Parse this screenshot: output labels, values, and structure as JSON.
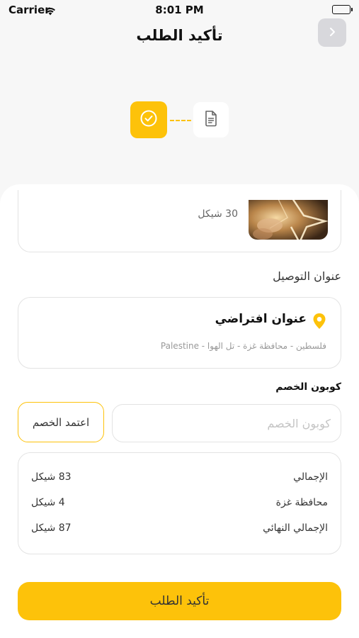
{
  "status_bar": {
    "carrier": "Carrier",
    "time": "8:01 PM"
  },
  "header": {
    "title": "تأكيد الطلب"
  },
  "steps": [
    {
      "icon": "check-circle-icon",
      "state": "completed"
    },
    {
      "icon": "document-icon",
      "state": "pending"
    }
  ],
  "product": {
    "price": "30 شيكل"
  },
  "address_section": {
    "title": "عنوان التوصيل",
    "name": "عنوان افتراضي",
    "detail": "فلسطين - محافظة غزة -   تل الهوا - Palestine"
  },
  "coupon": {
    "label": "كوبون الخصم",
    "placeholder": "كوبون الخصم",
    "value": "",
    "apply_label": "اعتمد الخصم"
  },
  "summary": {
    "rows": [
      {
        "label": "الإجمالي",
        "value": "83 شيكل"
      },
      {
        "label": "محافظة غزة",
        "value": "4 شيكل"
      },
      {
        "label": "الإجمالي النهائي",
        "value": "87 شيكل"
      }
    ]
  },
  "confirm_button": {
    "label": "تأكيد الطلب"
  },
  "colors": {
    "accent": "#fdc20a",
    "background": "#f7f7f7",
    "card_border": "#e3e3e3"
  }
}
